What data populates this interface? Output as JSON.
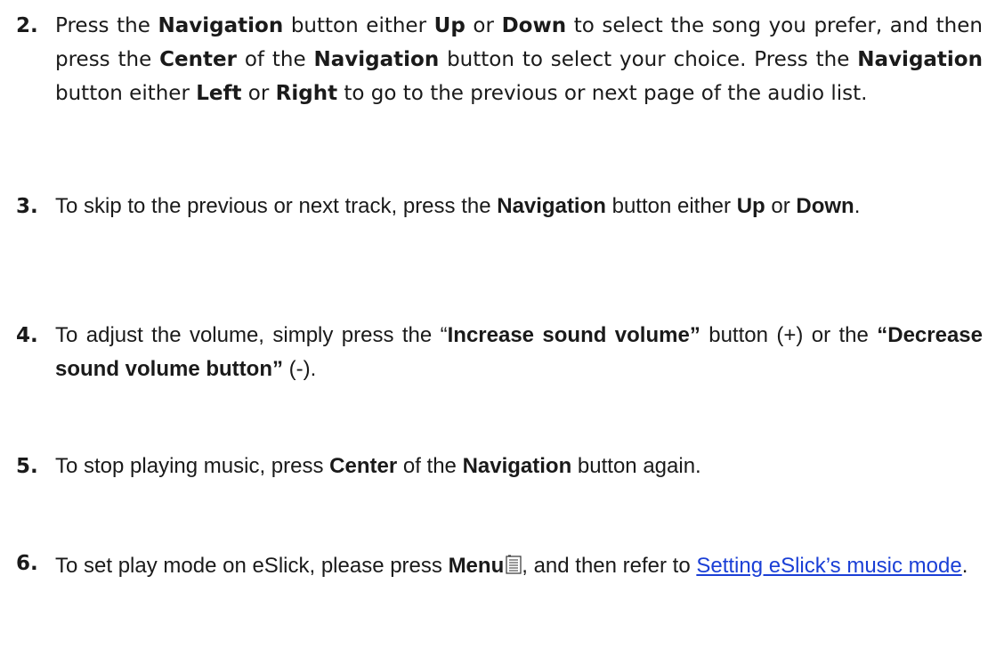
{
  "steps": [
    {
      "number": "2.",
      "parts": [
        {
          "t": "Press the "
        },
        {
          "t": "Navigation",
          "b": true
        },
        {
          "t": " button either "
        },
        {
          "t": "Up",
          "b": true
        },
        {
          "t": " or "
        },
        {
          "t": "Down",
          "b": true
        },
        {
          "t": " to select the song you prefer, and then press the "
        },
        {
          "t": "Center",
          "b": true
        },
        {
          "t": " of the "
        },
        {
          "t": "Navigation",
          "b": true
        },
        {
          "t": " button to select your choice. Press the "
        },
        {
          "t": "Navigation",
          "b": true
        },
        {
          "t": " button either "
        },
        {
          "t": "Left",
          "b": true
        },
        {
          "t": " or "
        },
        {
          "t": "Right",
          "b": true
        },
        {
          "t": " to go to the previous or next page of the audio list."
        }
      ]
    },
    {
      "number": "3.",
      "parts": [
        {
          "t": "To skip to the previous or next track, press the "
        },
        {
          "t": "Navigation",
          "b": true
        },
        {
          "t": " button either "
        },
        {
          "t": "Up",
          "b": true
        },
        {
          "t": " or "
        },
        {
          "t": "Down",
          "b": true
        },
        {
          "t": "."
        }
      ]
    },
    {
      "number": "4.",
      "parts": [
        {
          "t": "To adjust the volume, simply press the “"
        },
        {
          "t": "Increase sound volume”",
          "b": true
        },
        {
          "t": " button (+) or the "
        },
        {
          "t": "“Decrease sound volume button”",
          "b": true
        },
        {
          "t": " (-)."
        }
      ]
    },
    {
      "number": "5.",
      "parts": [
        {
          "t": "To stop playing music, press "
        },
        {
          "t": "Center",
          "b": true
        },
        {
          "t": " of the "
        },
        {
          "t": "Navigation",
          "b": true
        },
        {
          "t": " button again."
        }
      ]
    },
    {
      "number": "6.",
      "parts": [
        {
          "t": "To set play mode on eSlick, please press "
        },
        {
          "t": "Menu",
          "b": true
        },
        {
          "icon": "menu-list-icon"
        },
        {
          "t": ", and then refer to "
        },
        {
          "t": "Setting eSlick’s music mode",
          "link": true
        },
        {
          "t": "."
        }
      ]
    }
  ],
  "colors": {
    "text": "#1a1a1a",
    "link": "#1a3fd6"
  }
}
